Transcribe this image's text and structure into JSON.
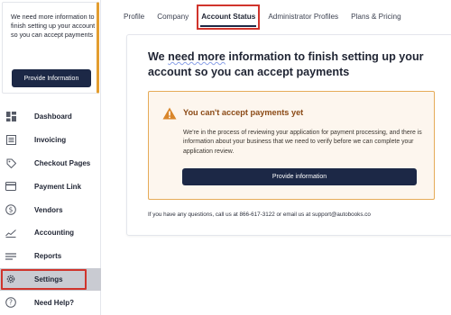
{
  "sidebar": {
    "promo": {
      "text": "We need more information to finish setting up your account so you can accept payments",
      "button_label": "Provide Information"
    },
    "items": [
      {
        "label": "Dashboard",
        "icon": "dashboard-icon"
      },
      {
        "label": "Invoicing",
        "icon": "invoice-icon"
      },
      {
        "label": "Checkout Pages",
        "icon": "tag-icon"
      },
      {
        "label": "Payment Link",
        "icon": "card-icon"
      },
      {
        "label": "Vendors",
        "icon": "dollar-icon"
      },
      {
        "label": "Accounting",
        "icon": "chart-icon"
      },
      {
        "label": "Reports",
        "icon": "reports-icon"
      },
      {
        "label": "Settings",
        "icon": "gear-icon",
        "active": true
      },
      {
        "label": "Need Help?",
        "icon": "help-icon"
      }
    ]
  },
  "tabs": [
    {
      "label": "Profile"
    },
    {
      "label": "Company"
    },
    {
      "label": "Account Status",
      "active": true
    },
    {
      "label": "Administrator Profiles"
    },
    {
      "label": "Plans & Pricing"
    }
  ],
  "main": {
    "title_part1": "We ",
    "title_part2": "need more",
    "title_part3": " information to finish setting up your account so you can accept payments",
    "warning": {
      "title": "You can't accept payments yet",
      "body": "We're in the process of reviewing your application for payment processing, and there is information about your business that we need to verify before we can complete your application review.",
      "button_label": "Provide information"
    },
    "contact": "If you have any questions, call us at 866-617-3122 or email us at support@autobooks.co"
  },
  "colors": {
    "primary": "#1c2846",
    "warning_border": "#e6ab58",
    "warning_bg": "#fdf6ee",
    "warning_title": "#8b4a16",
    "highlight_red": "#d0342c"
  }
}
